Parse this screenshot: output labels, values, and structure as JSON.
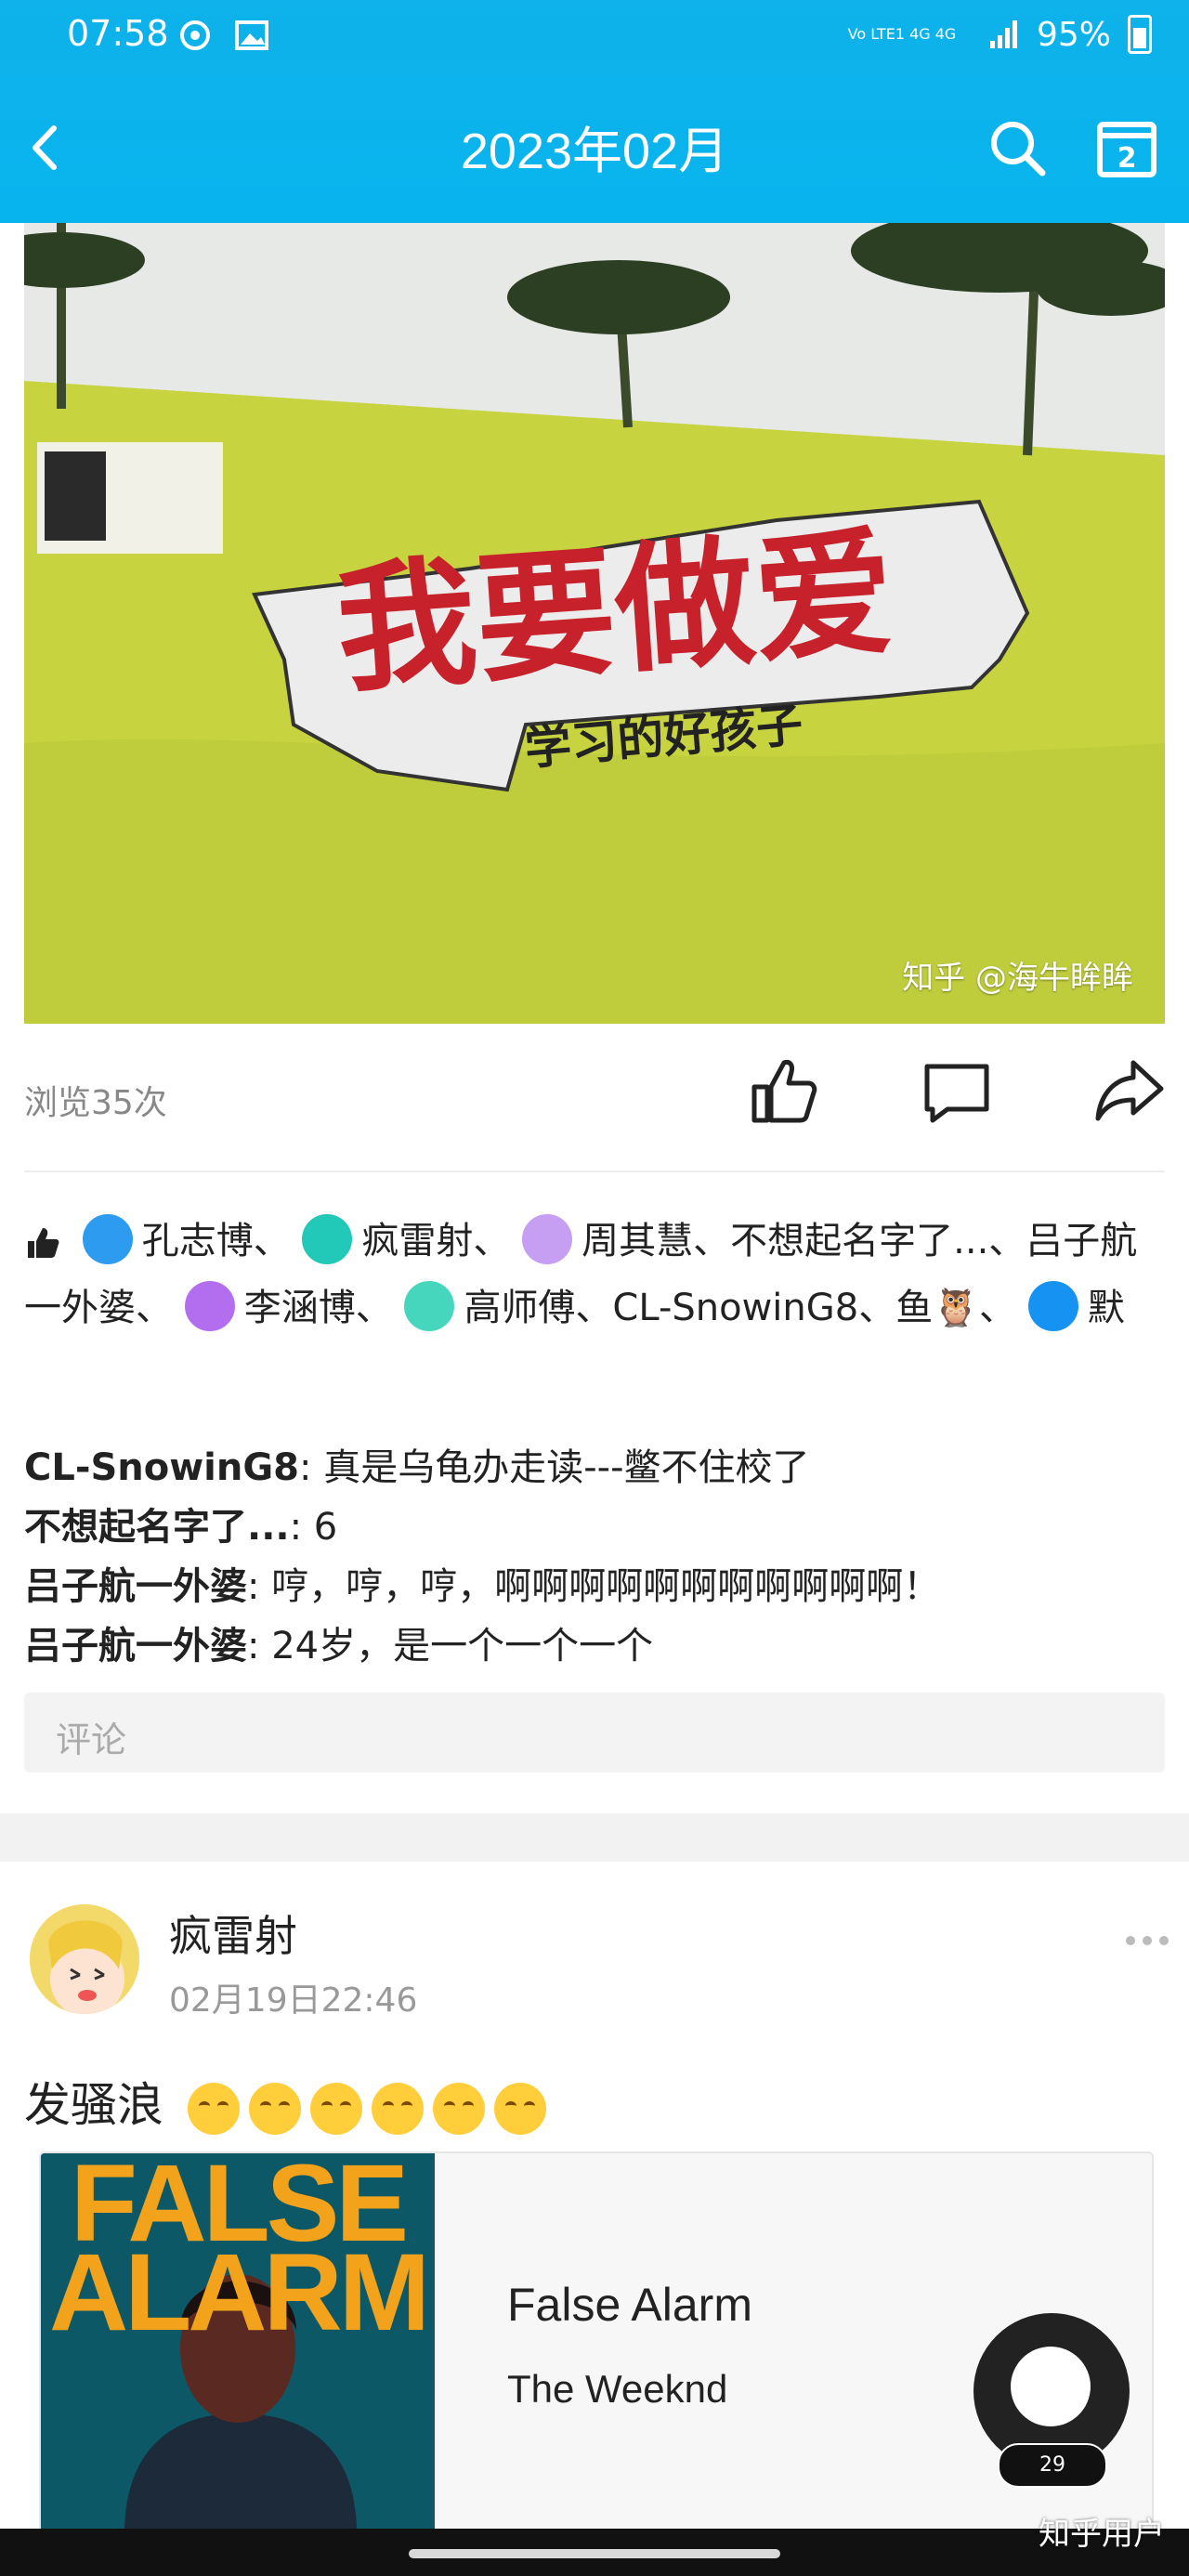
{
  "status_bar": {
    "time": "07:58",
    "network": "Vo LTE1 4G 4G",
    "battery": "95%"
  },
  "header": {
    "title": "2023年02月"
  },
  "photo": {
    "watermark": "知乎 @海牛眸眸",
    "sign_main": "我要做爱",
    "sign_sub": "学习的好孩子"
  },
  "stats": {
    "views": "浏览35次"
  },
  "likes": {
    "names": [
      "孔志博、",
      "疯雷射、",
      "周其慧、不想起名字了...、吕子航一外婆、",
      "李涵博、",
      "高师傅、CL-SnowinG8、鱼🦉、",
      "默"
    ]
  },
  "comments": [
    {
      "name": "CL-SnowinG8",
      "text": ": 真是乌龟办走读---鳖不住校了"
    },
    {
      "name": "不想起名字了...",
      "text": ": 6"
    },
    {
      "name": "吕子航一外婆",
      "text": ": 哼，哼，哼，啊啊啊啊啊啊啊啊啊啊啊！"
    },
    {
      "name": "吕子航一外婆",
      "text": ": 24岁，是一个一个一个"
    }
  ],
  "comment_input": {
    "placeholder": "评论"
  },
  "post": {
    "author": "疯雷射",
    "time": "02月19日22:46",
    "text": "发骚浪",
    "music": {
      "cover_text_1": "FALSE",
      "cover_text_2": "ALARM",
      "title": "False Alarm",
      "artist": "The Weeknd"
    }
  },
  "fab": {
    "badge": "29"
  },
  "footer": {
    "watermark": "知乎用户"
  }
}
